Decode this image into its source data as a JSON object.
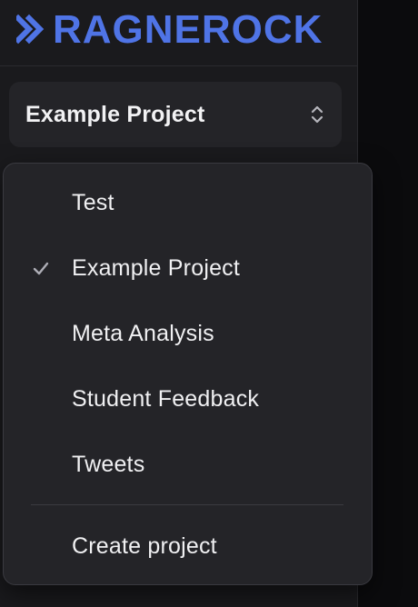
{
  "brand": {
    "name": "RAGNEROCK",
    "accent": "#4f74e6"
  },
  "project_switcher": {
    "selected_label": "Example Project",
    "indicator_icon": "chevron-updown-icon"
  },
  "dropdown": {
    "items": [
      {
        "label": "Test",
        "checked": false
      },
      {
        "label": "Example Project",
        "checked": true
      },
      {
        "label": "Meta Analysis",
        "checked": false
      },
      {
        "label": "Student Feedback",
        "checked": false
      },
      {
        "label": "Tweets",
        "checked": false
      }
    ],
    "footer_action": {
      "label": "Create project"
    }
  },
  "colors": {
    "sidebar_bg": "#1a1a1d",
    "menu_bg": "#242428",
    "text": "#f0f0f2",
    "border": "#3a3a40",
    "page_bg": "#0b0b0d"
  }
}
